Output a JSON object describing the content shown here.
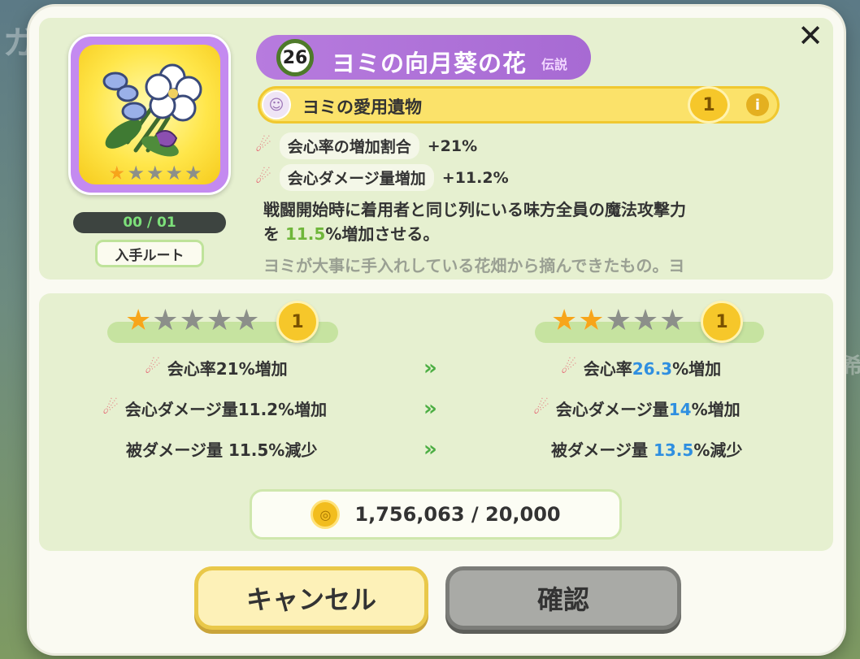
{
  "item": {
    "level": "26",
    "name": "ヨミの向月葵の花",
    "rarity": "伝説",
    "count": "00 / 01",
    "route_label": "入手ルート",
    "star_rating": 1,
    "max_stars": 5
  },
  "set": {
    "name": "ヨミの愛用遺物",
    "level": "1",
    "info_icon": "info-icon"
  },
  "stats": [
    {
      "label": "会心率の増加割合",
      "value": "+21%"
    },
    {
      "label": "会心ダメージ量増加",
      "value": "+11.2%"
    }
  ],
  "description": {
    "line1": "戦闘開始時に着用者と同じ列にいる味方全員の魔法攻撃力",
    "line2_pre": "を",
    "line2_hl": "11.5",
    "line2_post": "%増加させる。",
    "flavor": "ヨミが大事に手入れしている花畑から摘んできたもの。ヨ"
  },
  "upgrade": {
    "current": {
      "stars": 1,
      "level": "1",
      "lines": [
        {
          "text": "会心率21%増加"
        },
        {
          "text": "会心ダメージ量11.2%増加"
        },
        {
          "text": "被ダメージ量 11.5%減少"
        }
      ]
    },
    "next": {
      "stars": 2,
      "level": "1",
      "lines": [
        {
          "pre": "会心率",
          "hl": "26.3",
          "post": "%増加"
        },
        {
          "pre": "会心ダメージ量",
          "hl": "14",
          "post": "%増加"
        },
        {
          "pre": "被ダメージ量 ",
          "hl": "13.5",
          "post": "%減少"
        }
      ]
    }
  },
  "cost": {
    "text": "1,756,063 / 20,000"
  },
  "buttons": {
    "cancel": "キャンセル",
    "confirm": "確認"
  },
  "colors": {
    "accent_green": "#6fb63a",
    "highlight_blue": "#2f8fe0",
    "title_purple": "#b77bde",
    "set_yellow": "#fbe26a"
  }
}
